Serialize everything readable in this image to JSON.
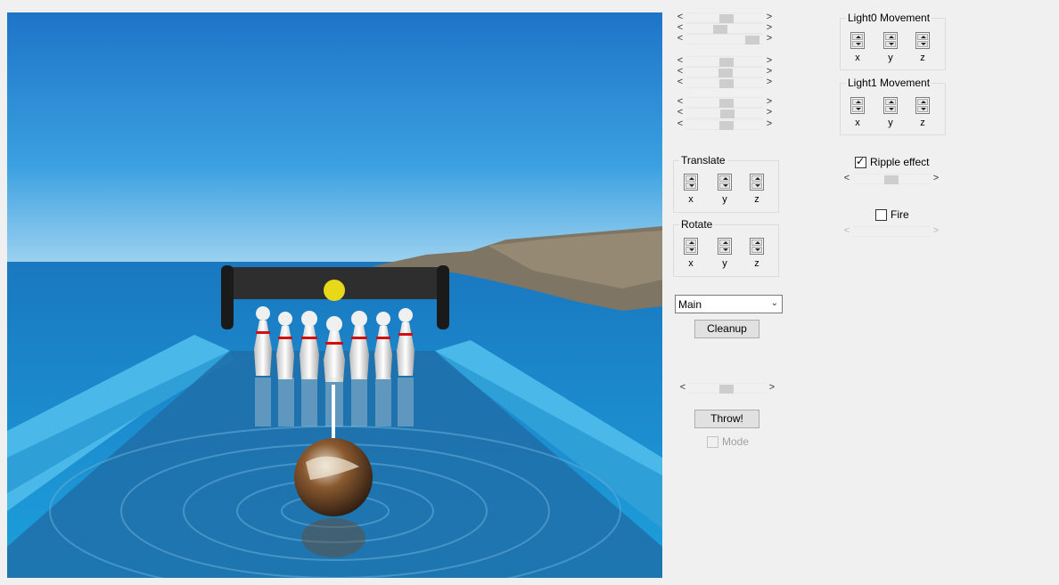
{
  "light0": {
    "title": "Light0 Movement",
    "axes": [
      "x",
      "y",
      "z"
    ]
  },
  "light1": {
    "title": "Light1 Movement",
    "axes": [
      "x",
      "y",
      "z"
    ]
  },
  "translate": {
    "title": "Translate",
    "axes": [
      "x",
      "y",
      "z"
    ]
  },
  "rotate": {
    "title": "Rotate",
    "axes": [
      "x",
      "y",
      "z"
    ]
  },
  "ripple": {
    "label": "Ripple effect",
    "checked": true
  },
  "fire": {
    "label": "Fire",
    "checked": false
  },
  "mode": {
    "label": "Mode",
    "checked": false,
    "enabled": false
  },
  "camera_select": {
    "value": "Main"
  },
  "cleanup_button": {
    "label": "Cleanup"
  },
  "throw_button": {
    "label": "Throw!"
  },
  "sliders": {
    "top_group1": [
      0.62,
      0.47,
      0.97
    ],
    "top_group2": [
      0.62,
      0.6,
      0.62
    ],
    "top_group3": [
      0.62,
      0.64,
      0.62
    ],
    "throw_power": 0.5,
    "ripple_strength": 0.5
  },
  "arrows": {
    "left": "<",
    "right": ">",
    "dropdown": "⌄"
  },
  "colors": {
    "window_bg": "#f0f0f0",
    "sky": "#2a7fc7",
    "sea": "#1f8bd0",
    "lane": "#45b6e8"
  }
}
